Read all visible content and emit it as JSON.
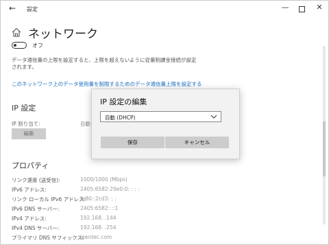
{
  "window": {
    "title": "設定",
    "controls": {
      "back": "←",
      "minimize": "—",
      "close": "✕"
    }
  },
  "page": {
    "title": "ネットワーク",
    "home_icon": "home-icon",
    "toggle_label": "オフ",
    "description": "データ通信量の上限を設定すると、上限を超えないように従量制課金接続が設定されます。",
    "link": "このネットワーク上のデータ使用量を制限するためのデータ通信量上限を設定する"
  },
  "ip_settings": {
    "heading": "IP 設定",
    "assign_label": "IP 割り当て:",
    "assign_value": "自動",
    "edit_button": "編集"
  },
  "properties": {
    "heading": "プロパティ",
    "rows": [
      {
        "label": "リンク速度 (送受信):",
        "value": "1000/1000 (Mbps)"
      },
      {
        "label": "IPv6 アドレス:",
        "value": "2405:6582:29e0:0:      :      :      :"
      },
      {
        "label": "リンク ローカル IPv6 アドレス:",
        "value": "fe80::2cd3:      :      :"
      },
      {
        "label": "IPv6 DNS サーバー:",
        "value": "2405:6582:      ::1"
      },
      {
        "label": "IPv4 アドレス:",
        "value": "192.168.    .144"
      },
      {
        "label": "IPv4 DNS サーバー:",
        "value": "192.168.    .254"
      },
      {
        "label": "プライマリ DNS サフィックス:",
        "value": "ipentec.com"
      }
    ]
  },
  "dialog": {
    "title": "IP 設定の編集",
    "select_value": "自動 (DHCP)",
    "save_button": "保存",
    "cancel_button": "キャンセル"
  }
}
